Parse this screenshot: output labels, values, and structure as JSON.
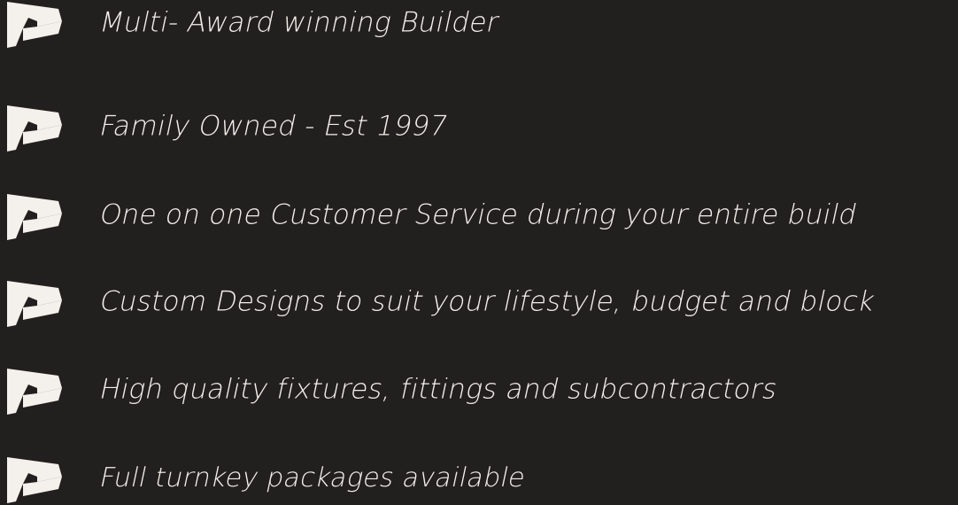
{
  "colors": {
    "background": "#221f1f",
    "text": "#f2efea",
    "icon": "#f4f1ec"
  },
  "features": [
    {
      "icon": "flag-logo-icon",
      "label": "Multi- Award winning Builder"
    },
    {
      "icon": "flag-logo-icon",
      "label": "Family Owned - Est 1997"
    },
    {
      "icon": "flag-logo-icon",
      "label": "One on one Customer Service during your entire build"
    },
    {
      "icon": "flag-logo-icon",
      "label": "Custom Designs to suit your lifestyle, budget and block"
    },
    {
      "icon": "flag-logo-icon",
      "label": "High quality fixtures, fittings and subcontractors"
    },
    {
      "icon": "flag-logo-icon",
      "label": "Full turnkey packages available"
    }
  ]
}
